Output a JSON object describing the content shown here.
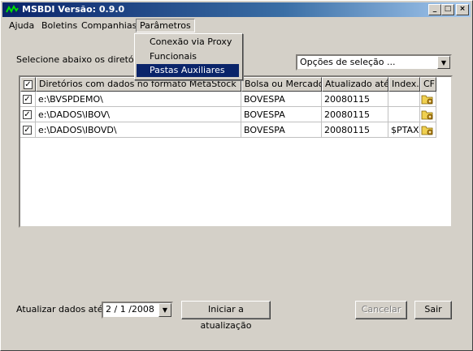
{
  "window": {
    "title": "MSBDI Versão: 0.9.0"
  },
  "menubar": {
    "items": [
      "Ajuda",
      "Boletins",
      "Companhias",
      "Parâmetros"
    ]
  },
  "dropdown_menu": {
    "items": [
      "Conexão via Proxy",
      "Funcionais",
      "Pastas Auxiliares"
    ],
    "selected": "Pastas Auxiliares"
  },
  "main": {
    "instruction": "Selecione abaixo os diretórios",
    "selection_combo": {
      "value": "Opções de seleção ..."
    }
  },
  "table": {
    "columns": [
      "Diretórios com dados no formato MetaStock",
      "Bolsa ou Mercado",
      "Atualizado até",
      "Index.",
      "CF"
    ],
    "rows": [
      {
        "checked": true,
        "dir": "e:\\BVSPDEMO\\",
        "bolsa": "BOVESPA",
        "date": "20080115",
        "index": ""
      },
      {
        "checked": true,
        "dir": "e:\\DADOS\\IBOV\\",
        "bolsa": "BOVESPA",
        "date": "20080115",
        "index": ""
      },
      {
        "checked": true,
        "dir": "e:\\DADOS\\IBOVD\\",
        "bolsa": "BOVESPA",
        "date": "20080115",
        "index": "$PTAX"
      }
    ]
  },
  "footer": {
    "date_label": "Atualizar dados até:",
    "date_value": "2 / 1 /2008",
    "start_button": "Iniciar a atualização",
    "cancel_button": "Cancelar",
    "exit_button": "Sair"
  },
  "colors": {
    "titlebar": "#0a246a",
    "face": "#d4d0c8",
    "selection": "#0a246a"
  }
}
